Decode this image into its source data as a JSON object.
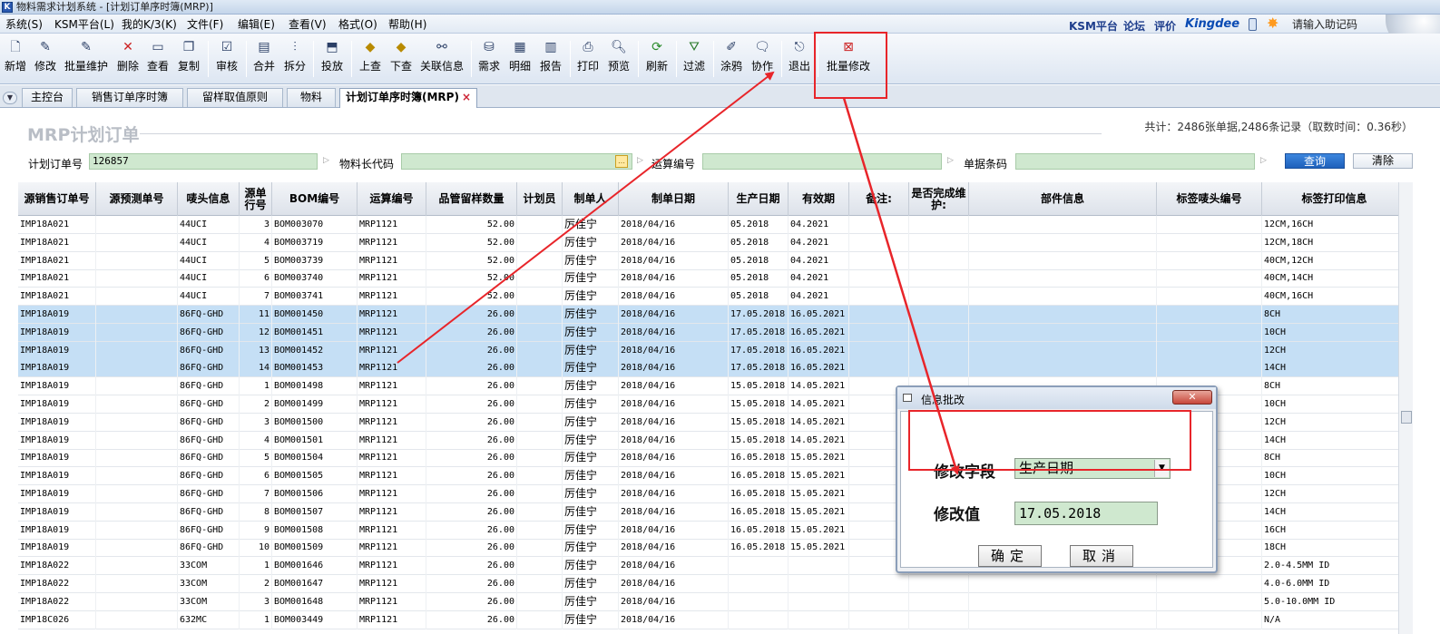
{
  "window": {
    "title": "物料需求计划系统 - [计划订单序时簿(MRP)]"
  },
  "menubar": {
    "items": [
      "系统(S)",
      "KSM平台(L)",
      "我的K/3(K)",
      "文件(F)",
      "编辑(E)",
      "查看(V)",
      "格式(O)",
      "帮助(H)"
    ],
    "brand_links": [
      "KSM平台",
      "论坛",
      "评价"
    ],
    "logo": "Kingdee",
    "help_input": "请输入助记码"
  },
  "toolbar": {
    "buttons": [
      {
        "label": "新增",
        "icon": "new-file-icon"
      },
      {
        "label": "修改",
        "icon": "edit-icon"
      },
      {
        "label": "批量维护",
        "icon": "batch-edit-icon"
      },
      {
        "label": "删除",
        "icon": "delete-icon"
      },
      {
        "label": "查看",
        "icon": "view-icon"
      },
      {
        "label": "复制",
        "icon": "copy-icon"
      },
      {
        "label": "审核",
        "icon": "audit-icon"
      },
      {
        "label": "合并",
        "icon": "merge-icon"
      },
      {
        "label": "拆分",
        "icon": "split-icon"
      },
      {
        "label": "投放",
        "icon": "release-icon"
      },
      {
        "label": "上查",
        "icon": "trace-up-icon"
      },
      {
        "label": "下查",
        "icon": "trace-down-icon"
      },
      {
        "label": "关联信息",
        "icon": "link-info-icon"
      },
      {
        "label": "需求",
        "icon": "demand-icon"
      },
      {
        "label": "明细",
        "icon": "detail-icon"
      },
      {
        "label": "报告",
        "icon": "report-icon"
      },
      {
        "label": "打印",
        "icon": "print-icon"
      },
      {
        "label": "预览",
        "icon": "preview-icon"
      },
      {
        "label": "刷新",
        "icon": "refresh-icon"
      },
      {
        "label": "过滤",
        "icon": "filter-icon"
      },
      {
        "label": "涂鸦",
        "icon": "scribble-icon"
      },
      {
        "label": "协作",
        "icon": "collaborate-icon"
      },
      {
        "label": "退出",
        "icon": "exit-icon"
      },
      {
        "label": "批量修改",
        "icon": "batch-modify-icon"
      }
    ]
  },
  "tabs": [
    {
      "label": "主控台"
    },
    {
      "label": "销售订单序时簿"
    },
    {
      "label": "留样取值原则"
    },
    {
      "label": "物料"
    },
    {
      "label": "计划订单序时簿(MRP)",
      "active": true
    }
  ],
  "page": {
    "heading": "MRP计划订单",
    "stats": "共计：2486张单据,2486条记录（取数时间：0.36秒）"
  },
  "filters": {
    "plan_order_label": "计划订单号",
    "plan_order_value": "126857",
    "material_label": "物料长代码",
    "material_value": "",
    "calc_label": "运算编号",
    "calc_value": "",
    "barcode_label": "单据条码",
    "barcode_value": "",
    "query_button": "查询",
    "clear_button": "清除"
  },
  "table": {
    "columns": [
      "源销售订单号",
      "源预测单号",
      "唛头信息",
      "源单行号",
      "BOM编号",
      "运算编号",
      "品管留样数量",
      "计划员",
      "制单人",
      "制单日期",
      "生产日期",
      "有效期",
      "备注:",
      "是否完成维护:",
      "部件信息",
      "标签唛头编号",
      "标签打印信息"
    ],
    "rows": [
      {
        "so": "IMP18A021",
        "fc": "",
        "mark": "44UCI",
        "line": "3",
        "bom": "BOM003070",
        "calc": "MRP1121",
        "qty": "52.00",
        "planner": "",
        "creator": "厉佳宁",
        "cdate": "2018/04/16",
        "pdate": "05.2018",
        "exp": "04.2021",
        "note": "",
        "done": "",
        "part": "",
        "tagno": "",
        "tag": "12CM,16CH",
        "sel": false
      },
      {
        "so": "IMP18A021",
        "fc": "",
        "mark": "44UCI",
        "line": "4",
        "bom": "BOM003719",
        "calc": "MRP1121",
        "qty": "52.00",
        "planner": "",
        "creator": "厉佳宁",
        "cdate": "2018/04/16",
        "pdate": "05.2018",
        "exp": "04.2021",
        "note": "",
        "done": "",
        "part": "",
        "tagno": "",
        "tag": "12CM,18CH",
        "sel": false
      },
      {
        "so": "IMP18A021",
        "fc": "",
        "mark": "44UCI",
        "line": "5",
        "bom": "BOM003739",
        "calc": "MRP1121",
        "qty": "52.00",
        "planner": "",
        "creator": "厉佳宁",
        "cdate": "2018/04/16",
        "pdate": "05.2018",
        "exp": "04.2021",
        "note": "",
        "done": "",
        "part": "",
        "tagno": "",
        "tag": "40CM,12CH",
        "sel": false
      },
      {
        "so": "IMP18A021",
        "fc": "",
        "mark": "44UCI",
        "line": "6",
        "bom": "BOM003740",
        "calc": "MRP1121",
        "qty": "52.00",
        "planner": "",
        "creator": "厉佳宁",
        "cdate": "2018/04/16",
        "pdate": "05.2018",
        "exp": "04.2021",
        "note": "",
        "done": "",
        "part": "",
        "tagno": "",
        "tag": "40CM,14CH",
        "sel": false
      },
      {
        "so": "IMP18A021",
        "fc": "",
        "mark": "44UCI",
        "line": "7",
        "bom": "BOM003741",
        "calc": "MRP1121",
        "qty": "52.00",
        "planner": "",
        "creator": "厉佳宁",
        "cdate": "2018/04/16",
        "pdate": "05.2018",
        "exp": "04.2021",
        "note": "",
        "done": "",
        "part": "",
        "tagno": "",
        "tag": "40CM,16CH",
        "sel": false
      },
      {
        "so": "IMP18A019",
        "fc": "",
        "mark": "86FQ-GHD",
        "line": "11",
        "bom": "BOM001450",
        "calc": "MRP1121",
        "qty": "26.00",
        "planner": "",
        "creator": "厉佳宁",
        "cdate": "2018/04/16",
        "pdate": "17.05.2018",
        "exp": "16.05.2021",
        "note": "",
        "done": "",
        "part": "",
        "tagno": "",
        "tag": "8CH",
        "sel": true
      },
      {
        "so": "IMP18A019",
        "fc": "",
        "mark": "86FQ-GHD",
        "line": "12",
        "bom": "BOM001451",
        "calc": "MRP1121",
        "qty": "26.00",
        "planner": "",
        "creator": "厉佳宁",
        "cdate": "2018/04/16",
        "pdate": "17.05.2018",
        "exp": "16.05.2021",
        "note": "",
        "done": "",
        "part": "",
        "tagno": "",
        "tag": "10CH",
        "sel": true
      },
      {
        "so": "IMP18A019",
        "fc": "",
        "mark": "86FQ-GHD",
        "line": "13",
        "bom": "BOM001452",
        "calc": "MRP1121",
        "qty": "26.00",
        "planner": "",
        "creator": "厉佳宁",
        "cdate": "2018/04/16",
        "pdate": "17.05.2018",
        "exp": "16.05.2021",
        "note": "",
        "done": "",
        "part": "",
        "tagno": "",
        "tag": "12CH",
        "sel": true
      },
      {
        "so": "IMP18A019",
        "fc": "",
        "mark": "86FQ-GHD",
        "line": "14",
        "bom": "BOM001453",
        "calc": "MRP1121",
        "qty": "26.00",
        "planner": "",
        "creator": "厉佳宁",
        "cdate": "2018/04/16",
        "pdate": "17.05.2018",
        "exp": "16.05.2021",
        "note": "",
        "done": "",
        "part": "",
        "tagno": "",
        "tag": "14CH",
        "sel": true
      },
      {
        "so": "IMP18A019",
        "fc": "",
        "mark": "86FQ-GHD",
        "line": "1",
        "bom": "BOM001498",
        "calc": "MRP1121",
        "qty": "26.00",
        "planner": "",
        "creator": "厉佳宁",
        "cdate": "2018/04/16",
        "pdate": "15.05.2018",
        "exp": "14.05.2021",
        "note": "",
        "done": "",
        "part": "",
        "tagno": "",
        "tag": "8CH",
        "sel": false
      },
      {
        "so": "IMP18A019",
        "fc": "",
        "mark": "86FQ-GHD",
        "line": "2",
        "bom": "BOM001499",
        "calc": "MRP1121",
        "qty": "26.00",
        "planner": "",
        "creator": "厉佳宁",
        "cdate": "2018/04/16",
        "pdate": "15.05.2018",
        "exp": "14.05.2021",
        "note": "",
        "done": "",
        "part": "",
        "tagno": "",
        "tag": "10CH",
        "sel": false
      },
      {
        "so": "IMP18A019",
        "fc": "",
        "mark": "86FQ-GHD",
        "line": "3",
        "bom": "BOM001500",
        "calc": "MRP1121",
        "qty": "26.00",
        "planner": "",
        "creator": "厉佳宁",
        "cdate": "2018/04/16",
        "pdate": "15.05.2018",
        "exp": "14.05.2021",
        "note": "",
        "done": "",
        "part": "",
        "tagno": "",
        "tag": "12CH",
        "sel": false
      },
      {
        "so": "IMP18A019",
        "fc": "",
        "mark": "86FQ-GHD",
        "line": "4",
        "bom": "BOM001501",
        "calc": "MRP1121",
        "qty": "26.00",
        "planner": "",
        "creator": "厉佳宁",
        "cdate": "2018/04/16",
        "pdate": "15.05.2018",
        "exp": "14.05.2021",
        "note": "",
        "done": "",
        "part": "",
        "tagno": "",
        "tag": "14CH",
        "sel": false
      },
      {
        "so": "IMP18A019",
        "fc": "",
        "mark": "86FQ-GHD",
        "line": "5",
        "bom": "BOM001504",
        "calc": "MRP1121",
        "qty": "26.00",
        "planner": "",
        "creator": "厉佳宁",
        "cdate": "2018/04/16",
        "pdate": "16.05.2018",
        "exp": "15.05.2021",
        "note": "",
        "done": "",
        "part": "",
        "tagno": "",
        "tag": "8CH",
        "sel": false
      },
      {
        "so": "IMP18A019",
        "fc": "",
        "mark": "86FQ-GHD",
        "line": "6",
        "bom": "BOM001505",
        "calc": "MRP1121",
        "qty": "26.00",
        "planner": "",
        "creator": "厉佳宁",
        "cdate": "2018/04/16",
        "pdate": "16.05.2018",
        "exp": "15.05.2021",
        "note": "",
        "done": "",
        "part": "",
        "tagno": "",
        "tag": "10CH",
        "sel": false
      },
      {
        "so": "IMP18A019",
        "fc": "",
        "mark": "86FQ-GHD",
        "line": "7",
        "bom": "BOM001506",
        "calc": "MRP1121",
        "qty": "26.00",
        "planner": "",
        "creator": "厉佳宁",
        "cdate": "2018/04/16",
        "pdate": "16.05.2018",
        "exp": "15.05.2021",
        "note": "",
        "done": "",
        "part": "",
        "tagno": "",
        "tag": "12CH",
        "sel": false
      },
      {
        "so": "IMP18A019",
        "fc": "",
        "mark": "86FQ-GHD",
        "line": "8",
        "bom": "BOM001507",
        "calc": "MRP1121",
        "qty": "26.00",
        "planner": "",
        "creator": "厉佳宁",
        "cdate": "2018/04/16",
        "pdate": "16.05.2018",
        "exp": "15.05.2021",
        "note": "",
        "done": "",
        "part": "",
        "tagno": "",
        "tag": "14CH",
        "sel": false
      },
      {
        "so": "IMP18A019",
        "fc": "",
        "mark": "86FQ-GHD",
        "line": "9",
        "bom": "BOM001508",
        "calc": "MRP1121",
        "qty": "26.00",
        "planner": "",
        "creator": "厉佳宁",
        "cdate": "2018/04/16",
        "pdate": "16.05.2018",
        "exp": "15.05.2021",
        "note": "",
        "done": "",
        "part": "",
        "tagno": "",
        "tag": "16CH",
        "sel": false
      },
      {
        "so": "IMP18A019",
        "fc": "",
        "mark": "86FQ-GHD",
        "line": "10",
        "bom": "BOM001509",
        "calc": "MRP1121",
        "qty": "26.00",
        "planner": "",
        "creator": "厉佳宁",
        "cdate": "2018/04/16",
        "pdate": "16.05.2018",
        "exp": "15.05.2021",
        "note": "",
        "done": "",
        "part": "",
        "tagno": "",
        "tag": "18CH",
        "sel": false
      },
      {
        "so": "IMP18A022",
        "fc": "",
        "mark": "33COM",
        "line": "1",
        "bom": "BOM001646",
        "calc": "MRP1121",
        "qty": "26.00",
        "planner": "",
        "creator": "厉佳宁",
        "cdate": "2018/04/16",
        "pdate": "",
        "exp": "",
        "note": "",
        "done": "",
        "part": "",
        "tagno": "",
        "tag": "2.0-4.5MM  ID",
        "sel": false
      },
      {
        "so": "IMP18A022",
        "fc": "",
        "mark": "33COM",
        "line": "2",
        "bom": "BOM001647",
        "calc": "MRP1121",
        "qty": "26.00",
        "planner": "",
        "creator": "厉佳宁",
        "cdate": "2018/04/16",
        "pdate": "",
        "exp": "",
        "note": "",
        "done": "",
        "part": "",
        "tagno": "",
        "tag": "4.0-6.0MM  ID",
        "sel": false
      },
      {
        "so": "IMP18A022",
        "fc": "",
        "mark": "33COM",
        "line": "3",
        "bom": "BOM001648",
        "calc": "MRP1121",
        "qty": "26.00",
        "planner": "",
        "creator": "厉佳宁",
        "cdate": "2018/04/16",
        "pdate": "",
        "exp": "",
        "note": "",
        "done": "",
        "part": "",
        "tagno": "",
        "tag": "5.0-10.0MM  ID",
        "sel": false
      },
      {
        "so": "IMP18C026",
        "fc": "",
        "mark": "632MC",
        "line": "1",
        "bom": "BOM003449",
        "calc": "MRP1121",
        "qty": "26.00",
        "planner": "",
        "creator": "厉佳宁",
        "cdate": "2018/04/16",
        "pdate": "",
        "exp": "",
        "note": "",
        "done": "",
        "part": "",
        "tagno": "",
        "tag": "N/A",
        "sel": false
      }
    ]
  },
  "dialog": {
    "title": "信息批改",
    "close_label": "✕",
    "field_label": "修改字段",
    "field_value": "生产日期",
    "value_label": "修改值",
    "value_value": "17.05.2018",
    "ok_button": "确定",
    "cancel_button": "取消"
  },
  "colors": {
    "annotation": "#e8252a",
    "selected_row": "#c5dff5",
    "input_green": "#cfe8cf",
    "query_blue": "#1e60bb"
  }
}
